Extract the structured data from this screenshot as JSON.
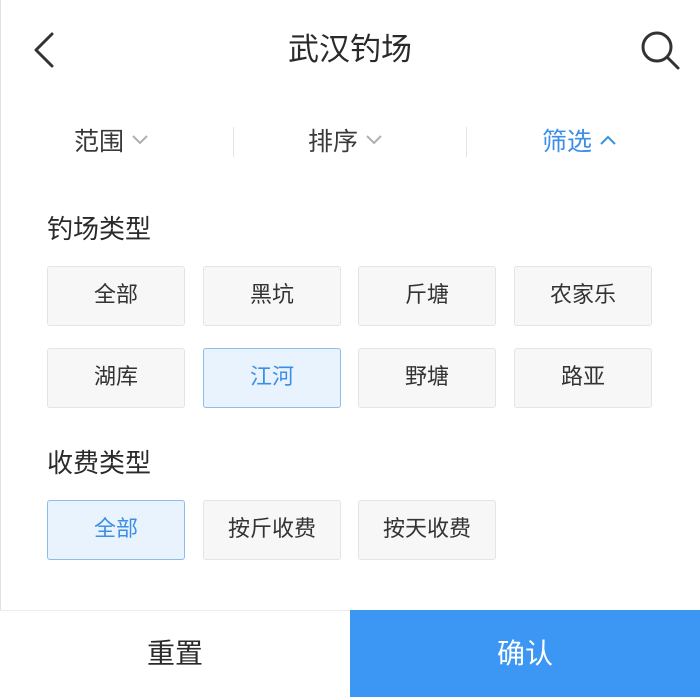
{
  "header": {
    "title": "武汉钓场",
    "back_icon": "chevron-left-icon",
    "search_icon": "search-icon"
  },
  "filter_bar": {
    "items": [
      {
        "label": "范围",
        "icon": "chevron-down-icon",
        "active": false
      },
      {
        "label": "排序",
        "icon": "chevron-down-icon",
        "active": false
      },
      {
        "label": "筛选",
        "icon": "chevron-up-icon",
        "active": true
      }
    ]
  },
  "venue_type": {
    "title": "钓场类型",
    "options": [
      {
        "label": "全部",
        "selected": false
      },
      {
        "label": "黑坑",
        "selected": false
      },
      {
        "label": "斤塘",
        "selected": false
      },
      {
        "label": "农家乐",
        "selected": false
      },
      {
        "label": "湖库",
        "selected": false
      },
      {
        "label": "江河",
        "selected": true
      },
      {
        "label": "野塘",
        "selected": false
      },
      {
        "label": "路亚",
        "selected": false
      }
    ]
  },
  "fee_type": {
    "title": "收费类型",
    "options": [
      {
        "label": "全部",
        "selected": true
      },
      {
        "label": "按斤收费",
        "selected": false
      },
      {
        "label": "按天收费",
        "selected": false
      }
    ]
  },
  "actions": {
    "reset_label": "重置",
    "confirm_label": "确认"
  },
  "colors": {
    "accent": "#3b97f3",
    "active_text": "#3d8fe6",
    "selected_bg": "#e9f3fd",
    "selected_border": "#8dbde9",
    "chip_bg": "#f7f7f7"
  }
}
